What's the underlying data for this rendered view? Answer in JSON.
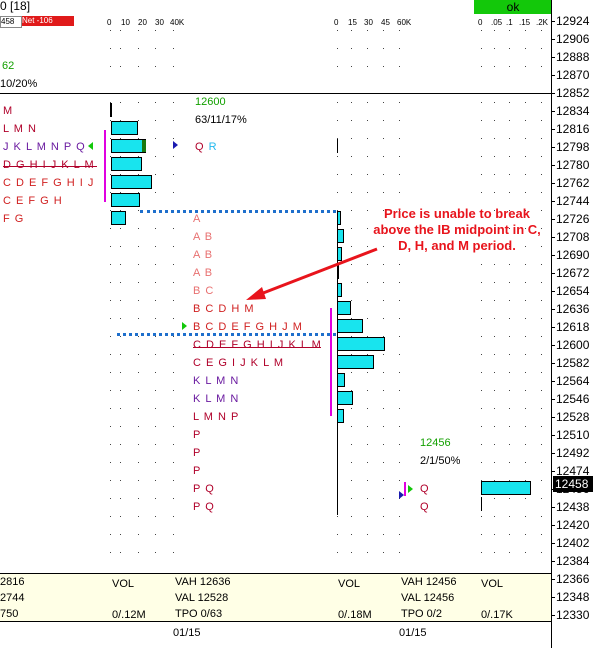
{
  "header": {
    "title_fragment": "0 [18]",
    "stat_a": "458",
    "stat_b": "Net -106",
    "ok_label": "ok"
  },
  "price_axis": [
    "12924",
    "12906",
    "12888",
    "12870",
    "12852",
    "12834",
    "12816",
    "12798",
    "12780",
    "12762",
    "12744",
    "12726",
    "12708",
    "12690",
    "12672",
    "12654",
    "12636",
    "12618",
    "12600",
    "12582",
    "12564",
    "12546",
    "12528",
    "12510",
    "12492",
    "12474",
    "12456",
    "12438",
    "12420",
    "12402",
    "12384",
    "12366",
    "12348",
    "12330"
  ],
  "current_price": "12458",
  "vol_scales": {
    "profile1": [
      "0",
      "10",
      "20",
      "30",
      "40K"
    ],
    "profile2": [
      "0",
      "15",
      "30",
      "45",
      "60K"
    ],
    "profile3": [
      "0",
      ".05",
      ".1",
      ".15",
      ".2K"
    ]
  },
  "profile0": {
    "top_a": "62",
    "top_b": "10/20%",
    "rows": [
      "M",
      "L M N",
      "J K L M N P Q",
      "D G H I J K L M",
      "C D E F G H I J",
      "C E F G H",
      "F G"
    ]
  },
  "profile1": {
    "poc": "12600",
    "stats": "63/11/17%",
    "tail": "Q R",
    "rows": [
      "A",
      "A B",
      "A B",
      "A B",
      "B C",
      "B C D H M",
      "B C D E F G H J M",
      "C D E F G H I J K L M",
      "C E G I J K L M",
      "K L M N",
      "K L M N",
      "L M N P",
      "P",
      "P",
      "P",
      "P Q",
      "P Q"
    ]
  },
  "profile2": {
    "poc": "12456",
    "stats": "2/1/50%",
    "rows": [
      "Q",
      "Q"
    ]
  },
  "annotation": {
    "text_lines": [
      "Price is unable to break",
      "above the IB midpoint in C,",
      "D, H, and M period."
    ],
    "color": "#e8141c"
  },
  "footer": {
    "col0": [
      "2816",
      "2744",
      "750"
    ],
    "vol1_label": "VOL",
    "vol1_value": "0/.12M",
    "vah1": "VAH 12636",
    "val1": "VAL 12528",
    "tpo1": "TPO 0/63",
    "vol2_label": "VOL",
    "vol2_value": "0/.18M",
    "vah2": "VAH 12456",
    "val2": "VAL 12456",
    "tpo2": "TPO 0/2",
    "vol3_label": "VOL",
    "vol3_value": "0/.17K",
    "date1": "01/15",
    "date2": "01/15"
  },
  "colors": {
    "volume_bar": "#18e4ee",
    "ib_line": "#1e6fcc",
    "magenta_line": "#e000e0",
    "header_green": "#13c80a",
    "header_red": "#e01a1a"
  }
}
